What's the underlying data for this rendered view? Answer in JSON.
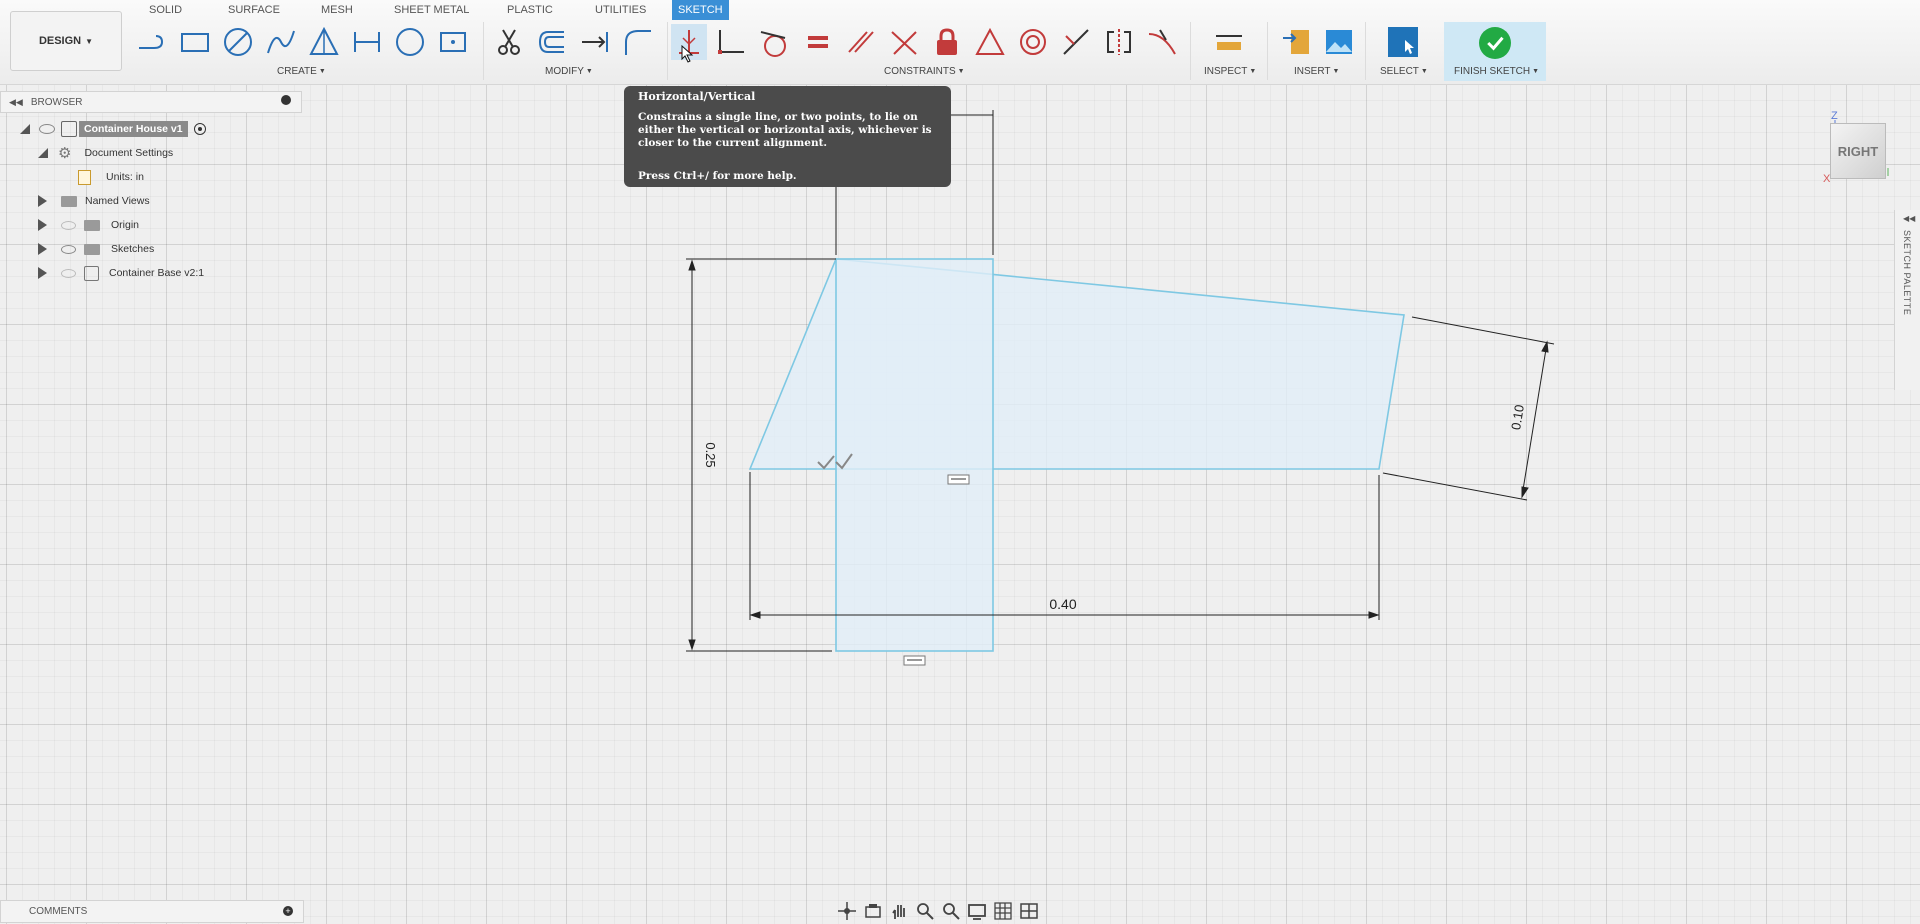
{
  "toolbar": {
    "workspace_button": "DESIGN",
    "tabs": [
      "SOLID",
      "SURFACE",
      "MESH",
      "SHEET METAL",
      "PLASTIC",
      "UTILITIES",
      "SKETCH"
    ],
    "groups": {
      "create": "CREATE",
      "modify": "MODIFY",
      "constraints": "CONSTRAINTS",
      "inspect": "INSPECT",
      "insert": "INSERT",
      "select": "SELECT",
      "finish": "FINISH SKETCH"
    }
  },
  "browser": {
    "title": "BROWSER",
    "items": [
      {
        "label": "Container House v1"
      },
      {
        "label": "Document Settings"
      },
      {
        "label": "Units: in"
      },
      {
        "label": "Named Views"
      },
      {
        "label": "Origin"
      },
      {
        "label": "Sketches"
      },
      {
        "label": "Container Base v2:1"
      }
    ]
  },
  "tooltip": {
    "title": "Horizontal/Vertical",
    "body": "Constrains a single line, or two points, to lie on either the vertical or horizontal axis, whichever is closer to the current alignment.",
    "help": "Press Ctrl+/ for more help."
  },
  "canvas": {
    "dimensions": [
      "0.25",
      "0.10",
      "0.40"
    ],
    "viewcube_label": "RIGHT",
    "axis_labels": {
      "z": "Z",
      "x": "X"
    }
  },
  "sketch_palette": {
    "label": "SKETCH PALETTE"
  },
  "comments": {
    "title": "COMMENTS"
  },
  "colors": {
    "active_tab": "#3a8fd6",
    "sketch_fill": "#e1eef8",
    "sketch_line": "#7ec8e3",
    "finish_green": "#22aa44",
    "tooltip_bg": "#4b4b4b"
  }
}
